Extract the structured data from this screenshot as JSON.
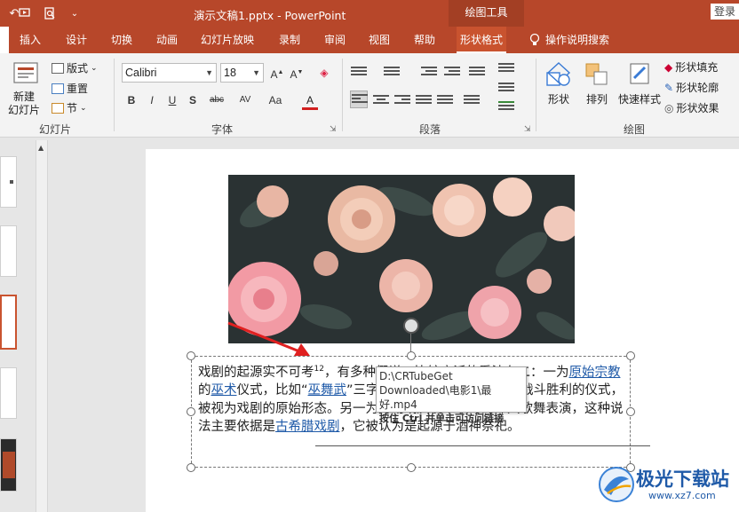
{
  "titlebar": {
    "document_title": "演示文稿1.pptx  -  PowerPoint",
    "context_tools": "绘图工具",
    "signin": "登录"
  },
  "tabs": [
    "插入",
    "设计",
    "切换",
    "动画",
    "幻灯片放映",
    "录制",
    "审阅",
    "视图",
    "帮助",
    "形状格式"
  ],
  "active_tab": "形状格式",
  "tell_me": "操作说明搜索",
  "ribbon": {
    "slides_group": {
      "new_slide": "新建\n幻灯片",
      "layout": "版式",
      "reset": "重置",
      "section": "节",
      "label": "幻灯片"
    },
    "font_group": {
      "font_name": "Calibri",
      "font_size": "18",
      "label": "字体"
    },
    "paragraph_group": {
      "label": "段落"
    },
    "drawing_group": {
      "shapes": "形状",
      "arrange": "排列",
      "quick_styles": "快速样式",
      "shape_fill": "形状填充",
      "shape_outline": "形状轮廓",
      "shape_effects": "形状效果",
      "label": "绘图"
    }
  },
  "slide": {
    "text_segments": [
      {
        "text": "戏剧的起源实不可考",
        "link": false
      },
      {
        "text": "12",
        "sup": true
      },
      {
        "text": "，有多种假说，比较广泛的看法有二：一为",
        "link": false
      },
      {
        "text": "原始宗教",
        "link": true
      },
      {
        "text": "的",
        "link": false
      },
      {
        "text": "巫术",
        "link": true
      },
      {
        "text": "仪式，比如",
        "link": false
      },
      {
        "text": "“",
        "link": false
      },
      {
        "text": "巫舞",
        "link": true
      },
      {
        "text": "武",
        "link": true
      },
      {
        "text": "”三字同源，可能是对一种乞求战斗胜利的仪式，被视为戏剧的原始形态。另一为劳动或庆祝丰收时的即兴歌舞表演，这种说法主要依据是",
        "link": false
      },
      {
        "text": "古希腊戏剧",
        "link": true
      },
      {
        "text": "，它被认为是起源于酒神祭祀。",
        "link": false
      }
    ],
    "tooltip": {
      "path_line1": "D:\\CRTubeGet",
      "path_line2": "Downloaded\\电影1\\最好.mp4",
      "hint": "按住 Ctrl 并单击可访问链接"
    }
  },
  "watermark": {
    "brand": "极光下载站",
    "url": "www.xz7.com"
  },
  "colors": {
    "accent": "#b7472a",
    "link": "#1f5aa8",
    "arrow": "#e02020"
  }
}
